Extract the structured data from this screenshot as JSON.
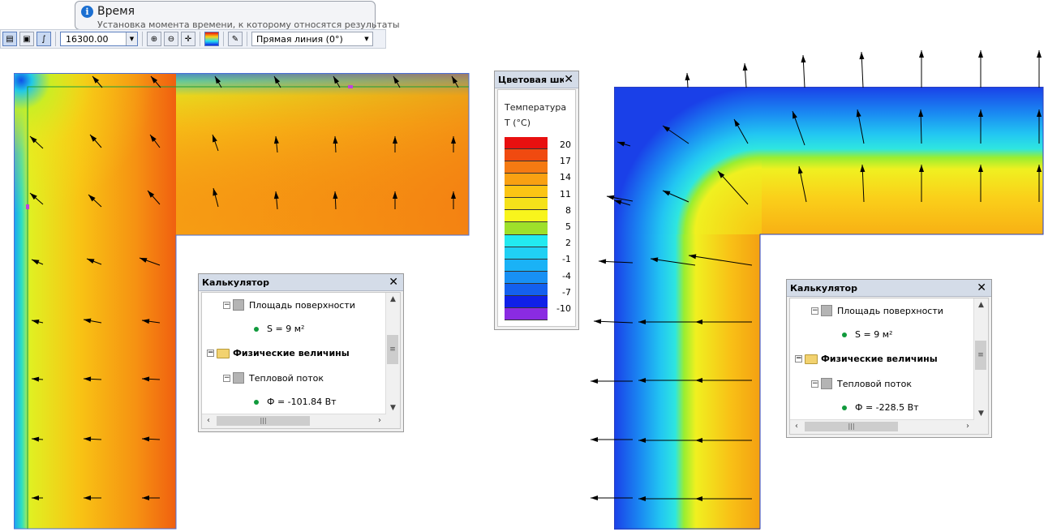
{
  "tooltip": {
    "title": "Время",
    "text": "Установка момента времени, к которому относятся результаты",
    "icon": "info-icon"
  },
  "toolbar": {
    "time_value": "16300.00",
    "line_mode": "Прямая линия (0°)"
  },
  "legend": {
    "title": "Цветовая шк...",
    "quantity": "Температура",
    "unit": "T (°C)",
    "ticks": [
      "20",
      "17",
      "14",
      "11",
      "8",
      "5",
      "2",
      "-1",
      "-4",
      "-7",
      "-10"
    ],
    "colors": [
      "#e81010",
      "#f04a10",
      "#f57a12",
      "#f9a112",
      "#fbc514",
      "#f5e21a",
      "#f8f51c",
      "#9ee02a",
      "#22eaf0",
      "#20d0f4",
      "#1ab2f6",
      "#1890f4",
      "#1460ee",
      "#1020e8",
      "#8a2be2"
    ]
  },
  "calc_left": {
    "title": "Калькулятор",
    "items": [
      {
        "label": "Площадь поверхности"
      },
      {
        "label": "S = 9 м²"
      },
      {
        "label": "Физические величины"
      },
      {
        "label": "Тепловой поток"
      },
      {
        "label": "Ф = -101.84 Вт"
      }
    ]
  },
  "calc_right": {
    "title": "Калькулятор",
    "items": [
      {
        "label": "Площадь поверхности"
      },
      {
        "label": "S = 9 м²"
      },
      {
        "label": "Физические величины"
      },
      {
        "label": "Тепловой поток"
      },
      {
        "label": "Ф = -228.5 Вт"
      }
    ]
  }
}
